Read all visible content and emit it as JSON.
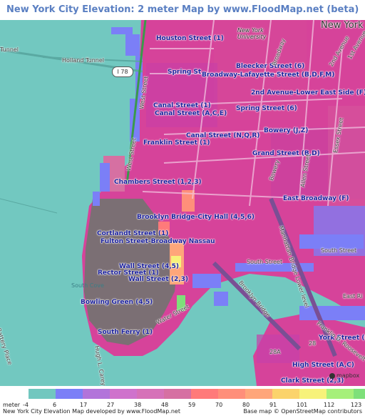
{
  "header": {
    "title": "New York City Elevation: 2 meter Map by www.FloodMap.net (beta)"
  },
  "map": {
    "places": [
      {
        "id": "new-york-big",
        "text": "New York"
      },
      {
        "id": "new-york-univ",
        "text": "New York\nUniversity"
      },
      {
        "id": "south-cove",
        "text": "South Cove"
      }
    ],
    "stations": [
      {
        "id": "houston",
        "text": "Houston Street (1)"
      },
      {
        "id": "spring-1",
        "text": "Spring St"
      },
      {
        "id": "bleecker",
        "text": "Bleecker Street (6)"
      },
      {
        "id": "broadway-lafayette",
        "text": "Broadway-Lafayette Street (B,D,F,M)"
      },
      {
        "id": "2nd-ave",
        "text": "2nd Avenue-Lower East Side (F)"
      },
      {
        "id": "canal-1",
        "text": "Canal Street (1)"
      },
      {
        "id": "canal-ace",
        "text": "Canal Street (A,C,E)"
      },
      {
        "id": "spring-6",
        "text": "Spring Street (6)"
      },
      {
        "id": "bowery",
        "text": "Bowery (J,Z)"
      },
      {
        "id": "canal-nqr",
        "text": "Canal Street (N,Q,R)"
      },
      {
        "id": "franklin",
        "text": "Franklin Street (1)"
      },
      {
        "id": "grand",
        "text": "Grand Street (B,D)"
      },
      {
        "id": "chambers",
        "text": "Chambers Street (1,2,3)"
      },
      {
        "id": "east-broadway",
        "text": "East Broadway (F)"
      },
      {
        "id": "brooklyn-bridge",
        "text": "Brooklyn Bridge-City Hall (4,5,6)"
      },
      {
        "id": "cortlandt",
        "text": "Cortlandt Street (1)"
      },
      {
        "id": "fulton",
        "text": "Fulton Street-Broadway Nassau"
      },
      {
        "id": "wall-45",
        "text": "Wall Street (4,5)"
      },
      {
        "id": "rector",
        "text": "Rector Street (1)"
      },
      {
        "id": "wall-23",
        "text": "Wall Street (2,3)"
      },
      {
        "id": "bowling-green",
        "text": "Bowling Green (4,5)"
      },
      {
        "id": "south-ferry",
        "text": "South Ferry (1)"
      },
      {
        "id": "york",
        "text": "York Street (F)"
      },
      {
        "id": "high",
        "text": "High Street (A,C)"
      },
      {
        "id": "clark",
        "text": "Clark Street (2,3)"
      }
    ],
    "roads": [
      {
        "id": "holland-tunnel-1",
        "text": "Holland Tunnel"
      },
      {
        "id": "tunnel-edge",
        "text": "Tunnel"
      },
      {
        "id": "west-street-1",
        "text": "West Street"
      },
      {
        "id": "west-street-2",
        "text": "West Street"
      },
      {
        "id": "broadway",
        "text": "Broadway"
      },
      {
        "id": "2nd-avenue",
        "text": "2nd Avenue"
      },
      {
        "id": "1st-avenue",
        "text": "1st Avenue"
      },
      {
        "id": "bowery-st",
        "text": "Bowery"
      },
      {
        "id": "allen",
        "text": "Allen Street"
      },
      {
        "id": "essex",
        "text": "Essex Street"
      },
      {
        "id": "south-street-1",
        "text": "South Street"
      },
      {
        "id": "south-street-2",
        "text": "South Street"
      },
      {
        "id": "brooklyn-bridge-road",
        "text": "Brooklyn Bridge"
      },
      {
        "id": "manhattan-bridge",
        "text": "Manhattan Bridge Lower level"
      },
      {
        "id": "water-street",
        "text": "Water Street"
      },
      {
        "id": "hugh-carey",
        "text": "Hugh L. Carey"
      },
      {
        "id": "battery",
        "text": "Battery Place"
      },
      {
        "id": "east-river",
        "text": "East Ri"
      },
      {
        "id": "fdr",
        "text": "Franklin D. Roosevelt"
      },
      {
        "id": "n28a",
        "text": "28A"
      },
      {
        "id": "n28",
        "text": "28"
      }
    ],
    "shield": "I 78",
    "mapbox": "mapbox"
  },
  "legend": {
    "unit": "meter",
    "ticks": [
      "-4",
      "6",
      "17",
      "27",
      "38",
      "48",
      "59",
      "70",
      "80",
      "91",
      "101",
      "112",
      "123"
    ],
    "colors": [
      "#71c7bf",
      "#7b7ff7",
      "#b274da",
      "#cf72cc",
      "#d671b8",
      "#d670a2",
      "#ff7a7a",
      "#ff8f7a",
      "#ffa67a",
      "#fbd36b",
      "#f7f27a",
      "#a6f07a",
      "#7ee07a"
    ],
    "credit_left": "New York City Elevation Map developed by www.FloodMap.net",
    "credit_right": "Base map © OpenStreetMap contributors"
  },
  "colors": {
    "title": "#5a7fc2",
    "water": "#72c8c0",
    "low_elevation": "#d6439a",
    "lowest_manhattan": "#7b6f74",
    "mid_elevation": "#ff8f7a"
  }
}
